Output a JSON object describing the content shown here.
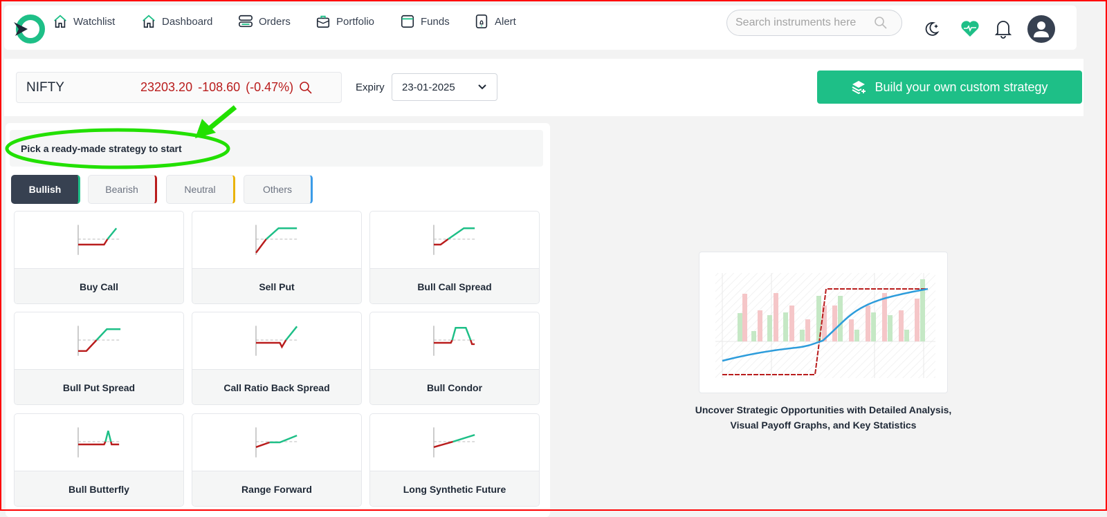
{
  "nav": {
    "items": [
      {
        "label": "Watchlist",
        "icon": "home-icon"
      },
      {
        "label": "Dashboard",
        "icon": "home-icon"
      },
      {
        "label": "Orders",
        "icon": "orders-icon"
      },
      {
        "label": "Portfolio",
        "icon": "briefcase-icon"
      },
      {
        "label": "Funds",
        "icon": "wallet-icon"
      },
      {
        "label": "Alert",
        "icon": "alert-phone-icon"
      }
    ],
    "search_placeholder": "Search instruments here"
  },
  "instrument": {
    "symbol": "NIFTY",
    "price": "23203.20",
    "change": "-108.60",
    "change_pct": "(-0.47%)",
    "expiry_label": "Expiry",
    "expiry_value": "23-01-2025"
  },
  "build_button": "Build your own custom strategy",
  "pick_title": "Pick a ready-made strategy to start",
  "tabs": [
    {
      "label": "Bullish",
      "accent": "#1ebf87",
      "active": true
    },
    {
      "label": "Bearish",
      "accent": "#b91c1c"
    },
    {
      "label": "Neutral",
      "accent": "#eab308"
    },
    {
      "label": "Others",
      "accent": "#3b9be8"
    }
  ],
  "strategies": [
    {
      "label": "Buy Call"
    },
    {
      "label": "Sell Put"
    },
    {
      "label": "Bull Call Spread"
    },
    {
      "label": "Bull Put Spread"
    },
    {
      "label": "Call Ratio Back Spread"
    },
    {
      "label": "Bull Condor"
    },
    {
      "label": "Bull Butterfly"
    },
    {
      "label": "Range Forward"
    },
    {
      "label": "Long Synthetic Future"
    }
  ],
  "caption_line1": "Uncover Strategic Opportunities with Detailed Analysis,",
  "caption_line2": "Visual Payoff Graphs, and Key Statistics",
  "colors": {
    "accent": "#1ebf87",
    "loss": "#b91c1c",
    "dark": "#374151",
    "annotation": "#22e000"
  }
}
